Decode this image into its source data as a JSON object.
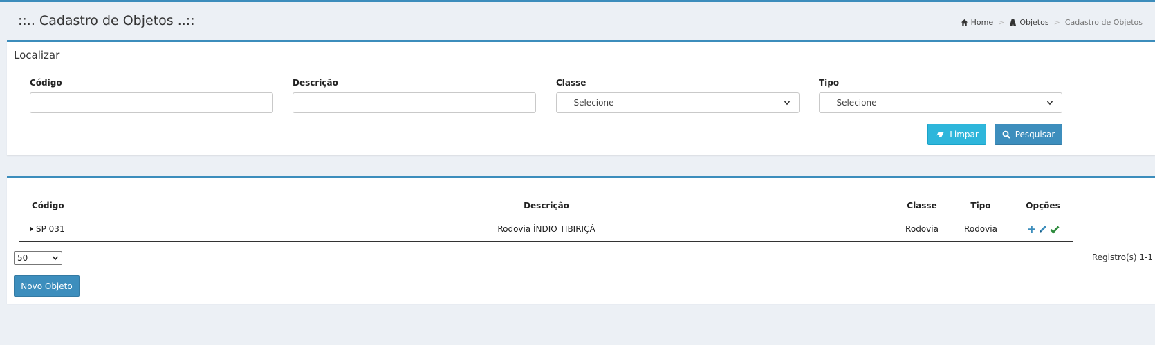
{
  "header": {
    "title": "::.. Cadastro de Objetos ..::",
    "breadcrumb": [
      "Home",
      "Objetos",
      "Cadastro de Objetos"
    ]
  },
  "search": {
    "title": "Localizar",
    "fields": {
      "codigo": {
        "label": "Código",
        "value": ""
      },
      "descricao": {
        "label": "Descrição",
        "value": ""
      },
      "classe": {
        "label": "Classe",
        "selected": "-- Selecione --"
      },
      "tipo": {
        "label": "Tipo",
        "selected": "-- Selecione --"
      }
    },
    "buttons": {
      "limpar": "Limpar",
      "pesquisar": "Pesquisar"
    }
  },
  "results": {
    "columns": [
      "Código",
      "Descrição",
      "Classe",
      "Tipo",
      "Opções"
    ],
    "rows": [
      {
        "codigo": "SP 031",
        "descricao": "Rodovia ÍNDIO TIBIRIÇÁ",
        "classe": "Rodovia",
        "tipo": "Rodovia"
      }
    ],
    "page_size": "50",
    "records": "Registro(s) 1-1",
    "new_button": "Novo Objeto"
  },
  "colors": {
    "accent": "#3c8dbc",
    "info": "#2eb6db",
    "success": "#2e8b3d"
  },
  "icons": [
    "home-icon",
    "road-icon",
    "eraser-icon",
    "search-icon",
    "plus-icon",
    "pencil-icon",
    "check-icon",
    "caret-right-icon",
    "chevron-down-icon"
  ]
}
